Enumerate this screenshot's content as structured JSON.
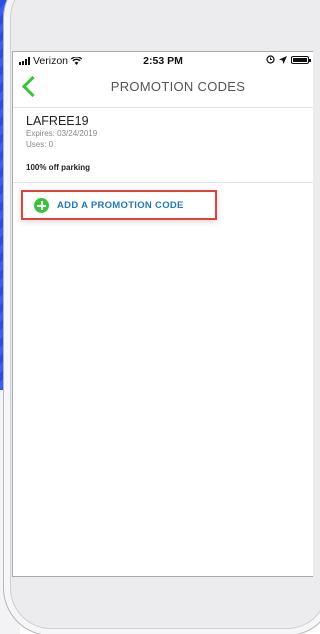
{
  "status_bar": {
    "carrier": "Verizon",
    "time": "2:53 PM",
    "right_icons": [
      "alarm-icon",
      "location-arrow-icon",
      "battery-icon"
    ]
  },
  "nav": {
    "back_icon": "chevron-left-icon",
    "title": "PROMOTION CODES"
  },
  "promo": {
    "code": "LAFREE19",
    "expires": "Expires: 03/24/2019",
    "uses": "Uses: 0",
    "description": "100% off parking"
  },
  "add_button": {
    "icon": "plus-circle-icon",
    "label": "ADD A PROMOTION CODE"
  },
  "colors": {
    "accent_green": "#3ac43a",
    "link_blue": "#1e7ab8",
    "highlight_red": "#e0413c",
    "background_blue": "#2a4fe0"
  }
}
